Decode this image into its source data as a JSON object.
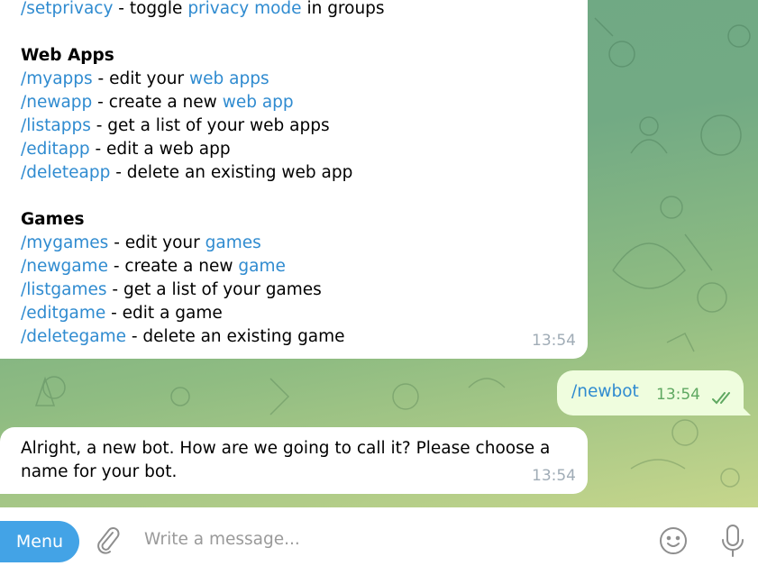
{
  "messages": {
    "bot_help": {
      "lines": [
        {
          "type": "cmd",
          "cmd": "/setprivacy",
          "sep": " - toggle ",
          "link": "privacy mode",
          "rest": " in groups"
        },
        {
          "type": "gap"
        },
        {
          "type": "heading",
          "text": "Web Apps"
        },
        {
          "type": "cmd",
          "cmd": "/myapps",
          "sep": " - edit your ",
          "link": "web apps",
          "rest": ""
        },
        {
          "type": "cmd",
          "cmd": "/newapp",
          "sep": " - create a new ",
          "link": "web app",
          "rest": ""
        },
        {
          "type": "cmd",
          "cmd": "/listapps",
          "sep": " - get a list of your web apps",
          "link": "",
          "rest": ""
        },
        {
          "type": "cmd",
          "cmd": "/editapp",
          "sep": " - edit a web app",
          "link": "",
          "rest": ""
        },
        {
          "type": "cmd",
          "cmd": "/deleteapp",
          "sep": " - delete an existing web app",
          "link": "",
          "rest": ""
        },
        {
          "type": "gap"
        },
        {
          "type": "heading",
          "text": "Games"
        },
        {
          "type": "cmd",
          "cmd": "/mygames",
          "sep": " - edit your ",
          "link": "games",
          "rest": ""
        },
        {
          "type": "cmd",
          "cmd": "/newgame",
          "sep": " - create a new ",
          "link": "game",
          "rest": ""
        },
        {
          "type": "cmd",
          "cmd": "/listgames",
          "sep": " - get a list of your games",
          "link": "",
          "rest": ""
        },
        {
          "type": "cmd",
          "cmd": "/editgame",
          "sep": " - edit a game",
          "link": "",
          "rest": ""
        },
        {
          "type": "cmd",
          "cmd": "/deletegame",
          "sep": " - delete an existing game",
          "link": "",
          "rest": ""
        }
      ],
      "time": "13:54"
    },
    "user_cmd": {
      "text": "/newbot",
      "time": "13:54",
      "status": "read-double-check"
    },
    "bot_reply": {
      "line1": "Alright, a new bot. How are we going to call it? Please choose a",
      "line2": "name for your bot.",
      "time": "13:54"
    }
  },
  "composer": {
    "menu_label": "Menu",
    "placeholder": "Write a message...",
    "value": "",
    "icons": [
      "paperclip-icon",
      "emoji-icon",
      "microphone-icon"
    ]
  },
  "colors": {
    "accent": "#43a3e6",
    "link": "#2f8bd0",
    "outgoing_bubble": "#effdde",
    "outgoing_time": "#5fa861",
    "incoming_time": "#a0acb6"
  }
}
